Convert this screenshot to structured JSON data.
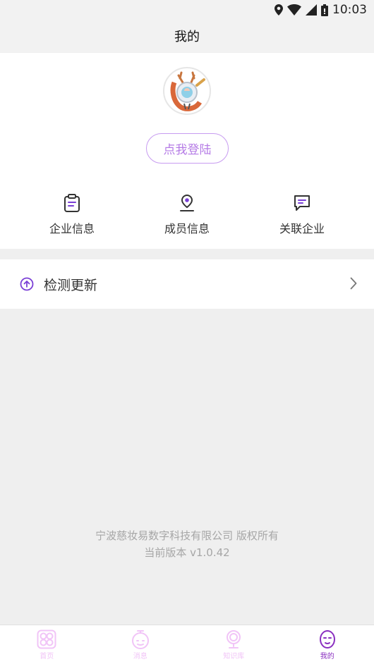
{
  "status_bar": {
    "time": "10:03"
  },
  "header": {
    "title": "我的"
  },
  "profile": {
    "login_label": "点我登陆"
  },
  "quick_links": [
    {
      "label": "企业信息",
      "icon": "clipboard-icon"
    },
    {
      "label": "成员信息",
      "icon": "person-icon"
    },
    {
      "label": "关联企业",
      "icon": "chat-icon"
    }
  ],
  "settings": {
    "check_update_label": "检测更新"
  },
  "footer": {
    "copyright": "宁波慈妆易数字科技有限公司 版权所有",
    "version": "当前版本 v1.0.42"
  },
  "tabs": [
    {
      "label": "首页",
      "icon": "home-grid-icon",
      "active": false
    },
    {
      "label": "消息",
      "icon": "message-bot-icon",
      "active": false
    },
    {
      "label": "知识库",
      "icon": "mirror-icon",
      "active": false
    },
    {
      "label": "我的",
      "icon": "face-icon",
      "active": true
    }
  ],
  "colors": {
    "accent": "#b57be6",
    "tab_active": "#8a2fc0",
    "tab_inactive": "#f1c4f7",
    "icon_purple": "#7a3fd6",
    "background": "#efefef"
  }
}
